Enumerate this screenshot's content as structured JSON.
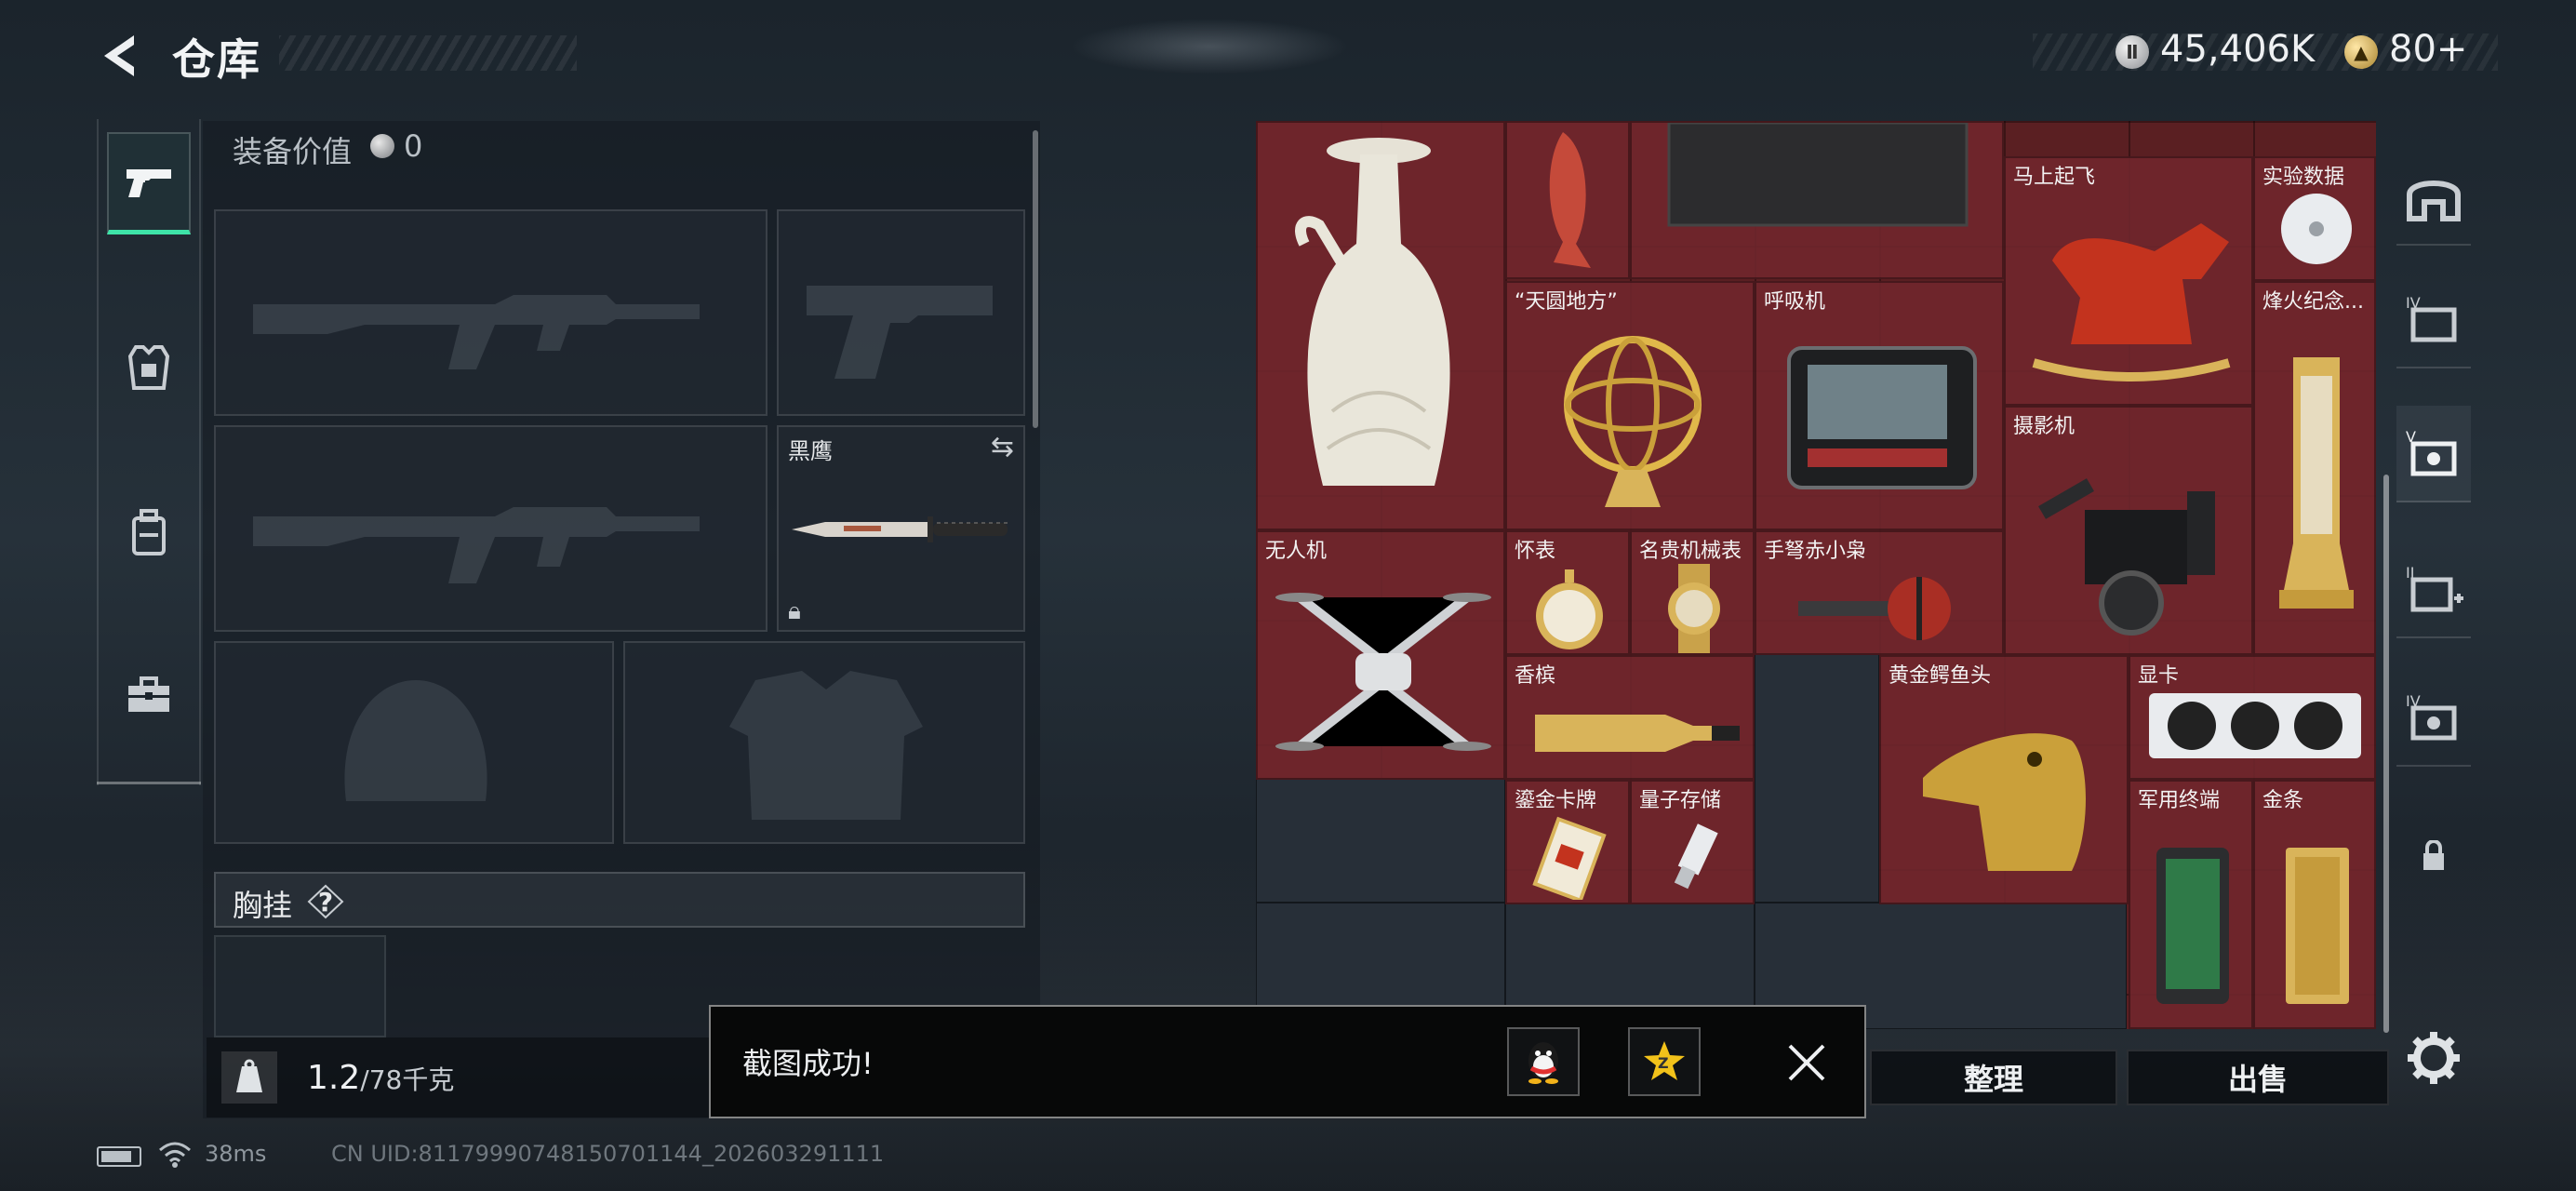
{
  "header": {
    "title": "仓库",
    "currency_primary": "45,406K",
    "currency_secondary": "80+"
  },
  "left_nav": {
    "items": [
      {
        "name": "weapons",
        "icon": "pistol-icon",
        "active": true
      },
      {
        "name": "gear",
        "icon": "armor-vest-icon",
        "active": false
      },
      {
        "name": "backpack",
        "icon": "backpack-icon",
        "active": false
      },
      {
        "name": "case",
        "icon": "toolbox-icon",
        "active": false
      }
    ]
  },
  "equipment": {
    "value_label": "装备价值",
    "value": "0",
    "melee_slot": {
      "label": "黑鹰"
    },
    "chest_label": "胸挂",
    "chest_help": "?",
    "weight_current": "1.2",
    "weight_max": "/78千克",
    "weight_icon_text": "KG"
  },
  "storage": {
    "items": [
      {
        "name": "",
        "art": "vase"
      },
      {
        "name": "",
        "art": "fish"
      },
      {
        "name": "",
        "art": "carpet"
      },
      {
        "name": "马上起飞",
        "art": "horse"
      },
      {
        "name": "实验数据",
        "art": "disc"
      },
      {
        "name": "“天圆地方”",
        "art": "armillary"
      },
      {
        "name": "呼吸机",
        "art": "ventilator"
      },
      {
        "name": "烽火纪念...",
        "art": "trophy"
      },
      {
        "name": "摄影机",
        "art": "camera"
      },
      {
        "name": "无人机",
        "art": "drone"
      },
      {
        "name": "怀表",
        "art": "pocketwatch"
      },
      {
        "name": "名贵机械表",
        "art": "wristwatch"
      },
      {
        "name": "手弩赤小枭",
        "art": "crossbow"
      },
      {
        "name": "香槟",
        "art": "champagne"
      },
      {
        "name": "黄金鳄鱼头",
        "art": "croc"
      },
      {
        "name": "显卡",
        "art": "gpu"
      },
      {
        "name": "鎏金卡牌",
        "art": "card"
      },
      {
        "name": "量子存储",
        "art": "usb"
      },
      {
        "name": "军用终端",
        "art": "terminal"
      },
      {
        "name": "金条",
        "art": "goldbar"
      }
    ]
  },
  "actions": {
    "organize": "整理",
    "sell": "出售"
  },
  "toast": {
    "message": "截图成功!",
    "qq_icon": "qq-icon",
    "qzone_icon": "qzone-star-icon"
  },
  "status": {
    "ping": "38ms",
    "uid": "CN UID:811799907481507011​44_202603291111"
  },
  "colors": {
    "accent": "#3ee3a8",
    "storage_bg": "#5a1f22",
    "item_bg": "#70262c"
  }
}
